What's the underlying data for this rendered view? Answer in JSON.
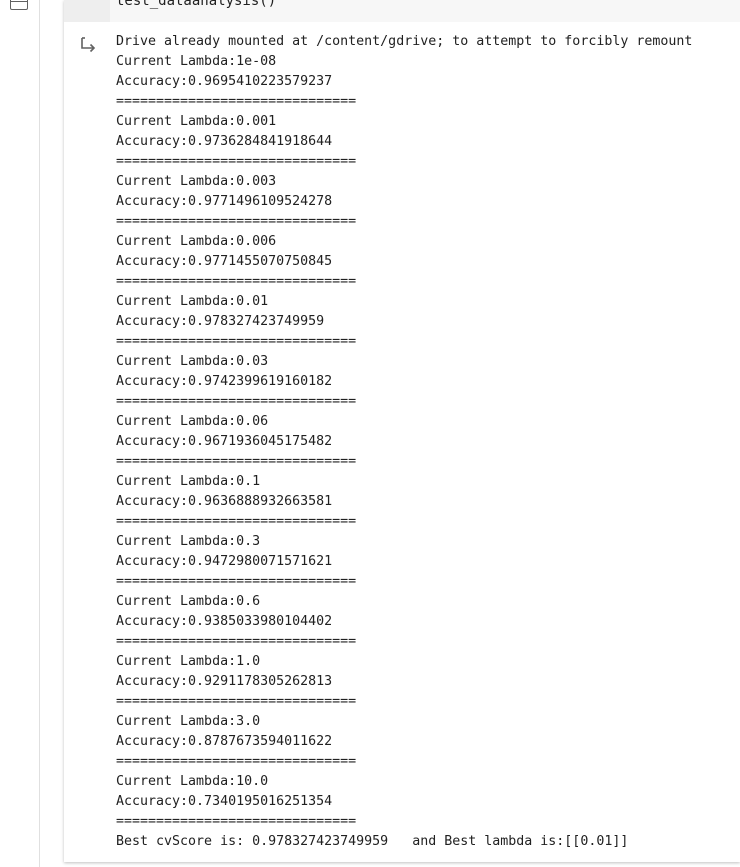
{
  "code_cell": {
    "code_line": "test_dataanalysis()"
  },
  "output": {
    "icon": "output-redirect-icon",
    "lines": [
      "Drive already mounted at /content/gdrive; to attempt to forcibly remount",
      "Current Lambda:1e-08",
      "Accuracy:0.9695410223579237",
      "==============================",
      "Current Lambda:0.001",
      "Accuracy:0.9736284841918644",
      "==============================",
      "Current Lambda:0.003",
      "Accuracy:0.9771496109524278",
      "==============================",
      "Current Lambda:0.006",
      "Accuracy:0.9771455070750845",
      "==============================",
      "Current Lambda:0.01",
      "Accuracy:0.978327423749959",
      "==============================",
      "Current Lambda:0.03",
      "Accuracy:0.9742399619160182",
      "==============================",
      "Current Lambda:0.06",
      "Accuracy:0.9671936045175482",
      "==============================",
      "Current Lambda:0.1",
      "Accuracy:0.9636888932663581",
      "==============================",
      "Current Lambda:0.3",
      "Accuracy:0.9472980071571621",
      "==============================",
      "Current Lambda:0.6",
      "Accuracy:0.9385033980104402",
      "==============================",
      "Current Lambda:1.0",
      "Accuracy:0.9291178305262813",
      "==============================",
      "Current Lambda:3.0",
      "Accuracy:0.8787673594011622",
      "==============================",
      "Current Lambda:10.0",
      "Accuracy:0.7340195016251354",
      "==============================",
      "Best cvScore is: 0.978327423749959   and Best lambda is:[[0.01]]"
    ]
  }
}
